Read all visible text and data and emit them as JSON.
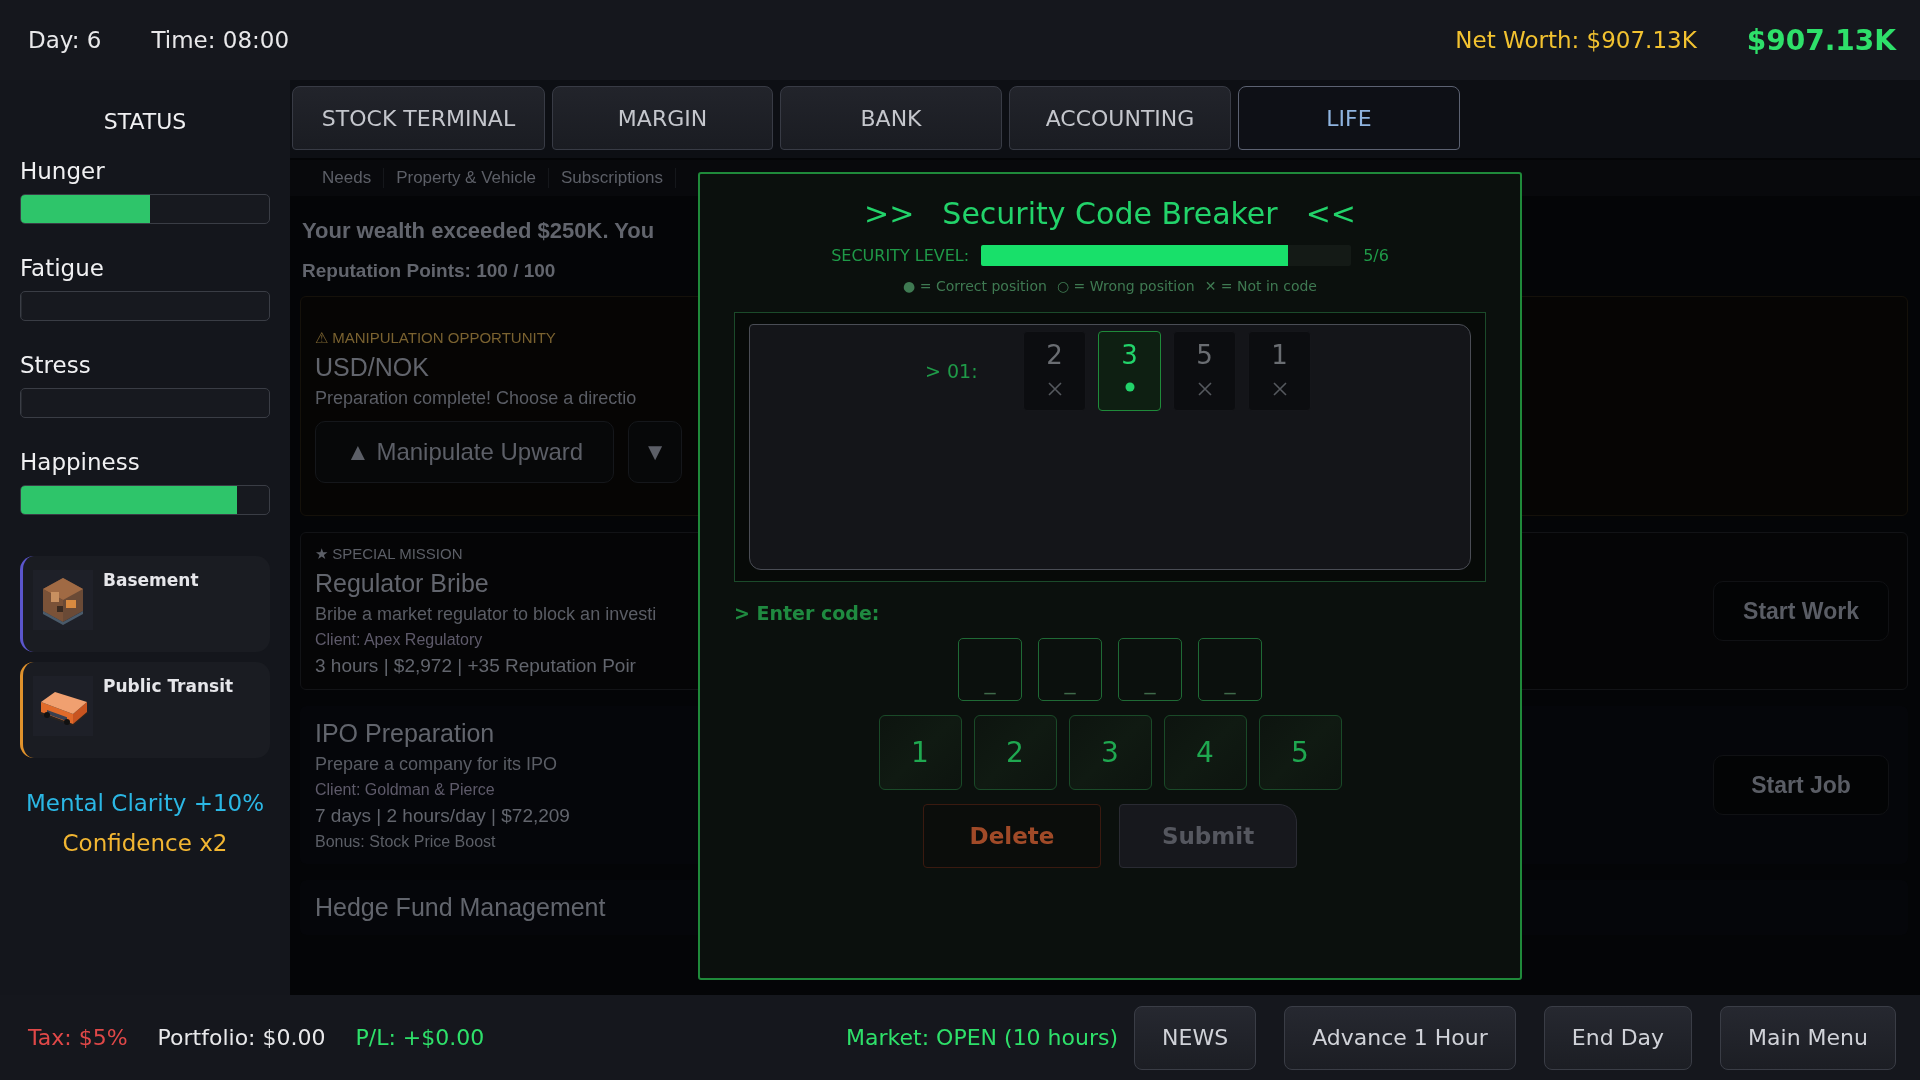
{
  "top_bar": {
    "day": "Day: 6",
    "time": "Time: 08:00",
    "net_worth": "Net Worth: $907.13K",
    "cash": "$907.13K"
  },
  "sidebar": {
    "title": "STATUS",
    "meters": [
      {
        "label": "Hunger",
        "level": 0.52
      },
      {
        "label": "Fatigue",
        "level": 0
      },
      {
        "label": "Stress",
        "level": 0
      },
      {
        "label": "Happiness",
        "level": 0.87
      }
    ],
    "assets": [
      {
        "name": "Basement",
        "color": "#5b56cc",
        "kind": "house"
      },
      {
        "name": "Public Transit",
        "color": "#e0922c",
        "kind": "bus"
      }
    ],
    "buffs": [
      {
        "text": "Mental Clarity +10%",
        "color": "#2bb7e4"
      },
      {
        "text": "Confidence x2",
        "color": "#f2b632"
      }
    ]
  },
  "tabs": [
    {
      "label": "STOCK TERMINAL",
      "selected": false
    },
    {
      "label": "MARGIN",
      "selected": false
    },
    {
      "label": "BANK",
      "selected": false
    },
    {
      "label": "ACCOUNTING",
      "selected": false
    },
    {
      "label": "LIFE",
      "selected": true
    }
  ],
  "life": {
    "subtabs": [
      "Needs",
      "Property & Vehicle",
      "Subscriptions"
    ],
    "notice": "Your wealth exceeded $250K. You",
    "reputation": "Reputation Points: 100 / 100",
    "manipulation": {
      "tag": "⚠ MANIPULATION OPPORTUNITY",
      "title": "USD/NOK",
      "text": "Preparation complete! Choose a directio",
      "buttons": [
        "▲ Manipulate Upward",
        "▼"
      ]
    },
    "jobs": [
      {
        "kind": "mission",
        "tag": "★ SPECIAL MISSION",
        "title": "Regulator Bribe",
        "description": "Bribe a market regulator to block an investi",
        "client": "Client: Apex Regulatory",
        "details": "3 hours  |  $2,972  |  +35 Reputation Poir",
        "action": "Start Work"
      },
      {
        "kind": "job",
        "title": "IPO Preparation",
        "description": "Prepare a company for its IPO",
        "client": "Client: Goldman & Pierce",
        "details": "7 days  |  2 hours/day  |  $72,209",
        "bonus": "Bonus: Stock Price Boost",
        "action": "Start Job"
      },
      {
        "kind": "job",
        "title": "Hedge Fund Management"
      }
    ]
  },
  "code_breaker": {
    "open": ">>",
    "title": "Security Code Breaker",
    "close": "<<",
    "level_label": "SECURITY LEVEL:",
    "level": 0.83,
    "level_text": "5/6",
    "legend": [
      "● = Correct position",
      "○ = Wrong position",
      "✕ = Not in code"
    ],
    "history": [
      {
        "label": "> 01:",
        "cells": [
          {
            "digit": "2",
            "kind": "absent"
          },
          {
            "digit": "3",
            "kind": "correct"
          },
          {
            "digit": "5",
            "kind": "absent"
          },
          {
            "digit": "1",
            "kind": "absent"
          }
        ]
      }
    ],
    "prompt": "> Enter code:",
    "slots": [
      "_",
      "_",
      "_",
      "_"
    ],
    "keys": [
      "1",
      "2",
      "3",
      "4",
      "5"
    ],
    "actions": [
      {
        "label": "Delete",
        "kind": "delete",
        "disabled": false
      },
      {
        "label": "Submit",
        "kind": "submit",
        "disabled": true
      }
    ]
  },
  "status_bar": {
    "tax": "Tax: $5%",
    "portfolio": "Portfolio: $0.00",
    "pl": "P/L: +$0.00",
    "market": "Market: OPEN (10 hours)",
    "buttons": [
      "NEWS",
      "Advance 1 Hour",
      "End Day",
      "Main Menu"
    ]
  }
}
